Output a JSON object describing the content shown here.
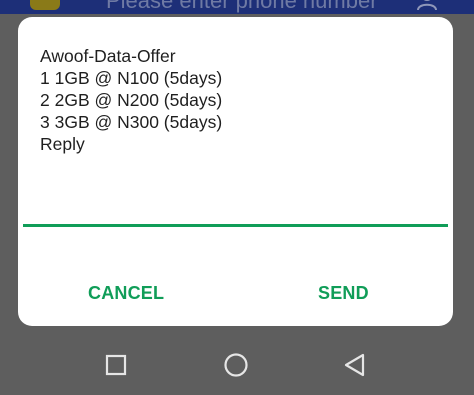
{
  "app_header": {
    "phone_placeholder": "Please enter phone number"
  },
  "dialog": {
    "message_lines": [
      "Awoof-Data-Offer",
      "1 1GB @ N100 (5days)",
      "2 2GB @ N200 (5days)",
      "3 3GB @ N300 (5days)",
      "Reply"
    ],
    "reply_input_value": "",
    "cancel_label": "CANCEL",
    "send_label": "SEND"
  },
  "navigation": {
    "recents_icon": "square-icon",
    "home_icon": "circle-icon",
    "back_icon": "triangle-back-icon"
  },
  "colors": {
    "accent": "#109d58",
    "dialog_background": "#ffffff",
    "scrim": "#5e5e5e",
    "header": "#1d2f78"
  }
}
